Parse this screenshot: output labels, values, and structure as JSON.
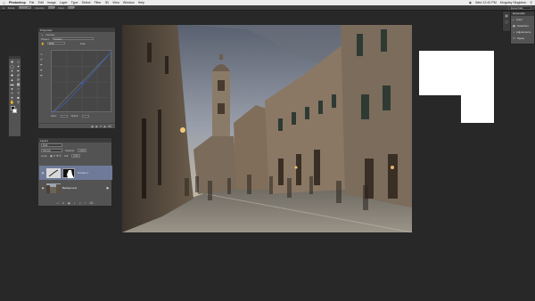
{
  "menubar": {
    "app_name": "Photoshop",
    "items": [
      "File",
      "Edit",
      "Image",
      "Layer",
      "Type",
      "Select",
      "Filter",
      "3D",
      "View",
      "Window",
      "Help"
    ],
    "clock": "Wed 12:42 PM",
    "user": "Kingsley Singleton"
  },
  "options_bar": {
    "mode_label": "Mode:",
    "mode_value": "Normal",
    "opacity_label": "Opacity:",
    "opacity_value": "100%",
    "flow_label": "Flow:",
    "flow_value": "100%",
    "workspace": "Essentials"
  },
  "properties": {
    "tab": "Properties",
    "adjustment": "Curves",
    "preset_label": "Preset:",
    "preset_value": "Custom",
    "channel_value": "RGB",
    "auto_label": "Auto",
    "input_label": "Input:",
    "output_label": "Output:"
  },
  "layers": {
    "tab": "Layers",
    "kind_label": "Kind",
    "blend_value": "Normal",
    "opacity_label": "Opacity:",
    "opacity_value": "100%",
    "lock_label": "Lock:",
    "fill_label": "Fill:",
    "fill_value": "100%",
    "items": [
      {
        "name": "Curves 1",
        "active": true
      },
      {
        "name": "Background",
        "active": false
      }
    ]
  },
  "right_panel": {
    "header": "Essentials",
    "items": [
      {
        "label": "Color",
        "icon": "color-icon"
      },
      {
        "label": "Swatches",
        "icon": "swatches-icon"
      },
      {
        "label": "Adjustments",
        "icon": "adjustments-icon"
      },
      {
        "label": "Styles",
        "icon": "styles-icon"
      }
    ]
  },
  "colors": {
    "canvas_bg": "#282828",
    "panel_bg": "#535353",
    "active_layer": "#6f7a98"
  }
}
